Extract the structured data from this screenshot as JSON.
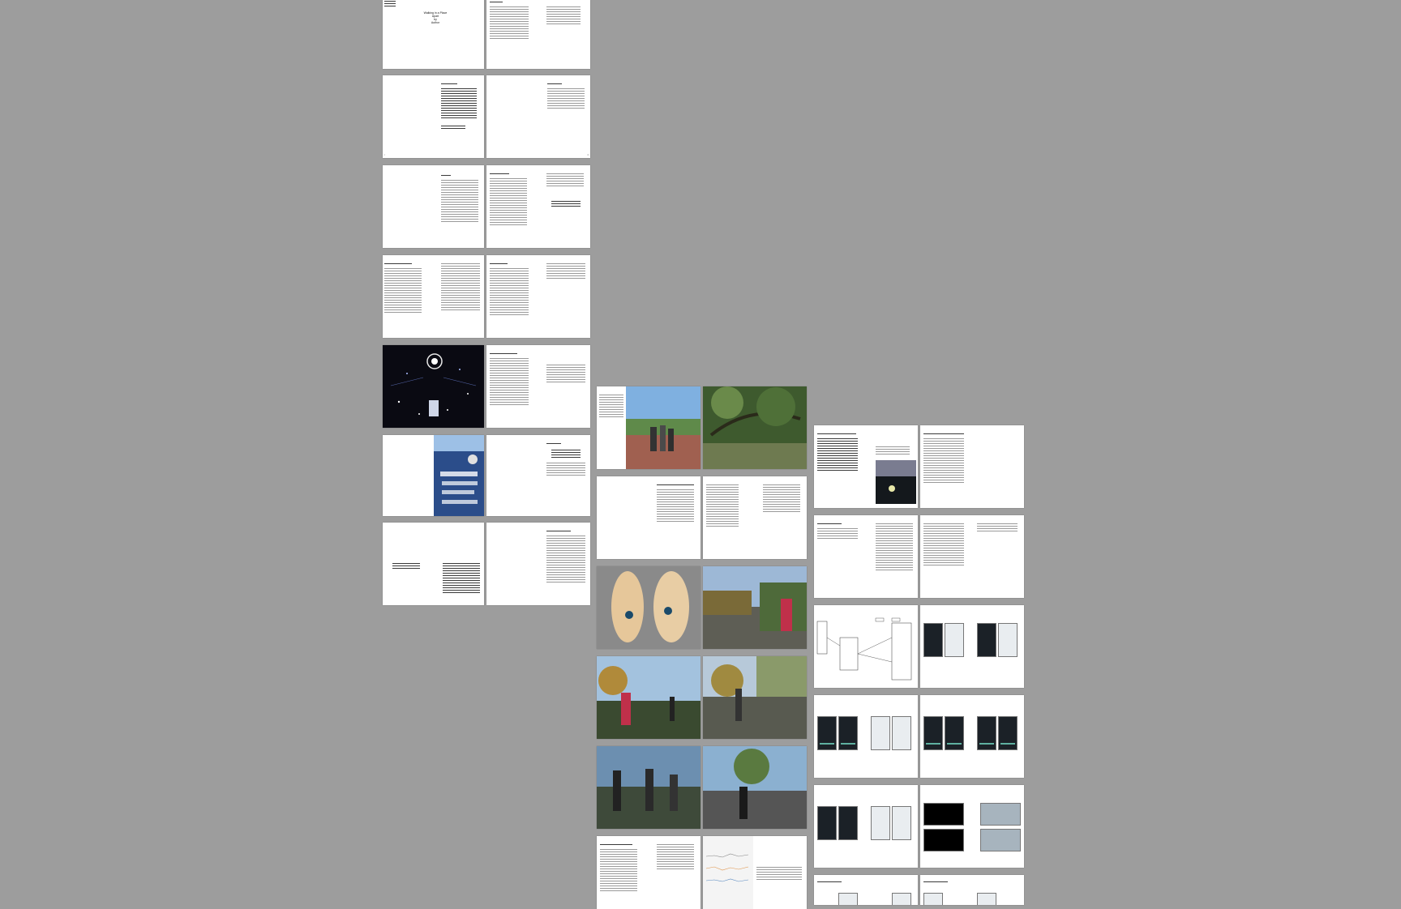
{
  "viewer": {
    "background": "#9d9d9d"
  },
  "title_page": {
    "line1": "Walking in a Place",
    "line2": "Apart",
    "line3": "by",
    "line4": "Author"
  },
  "contents": {
    "heading": "Contents"
  },
  "acknowledgements": {
    "heading": "Acknowledgements"
  },
  "abstract": {
    "heading": "A note to Reader"
  },
  "preface": {
    "heading": "Preface"
  },
  "introduction": {
    "heading": "Introduction"
  },
  "chapter1": {
    "heading": "Walking in a Place: Introduction"
  },
  "chapter2": {
    "heading": "Project Notes"
  },
  "chapter3": {
    "heading": "Methodology"
  },
  "conclusion": {
    "heading": "Conclusion"
  },
  "appendix_note": {
    "heading": "Appendix"
  }
}
